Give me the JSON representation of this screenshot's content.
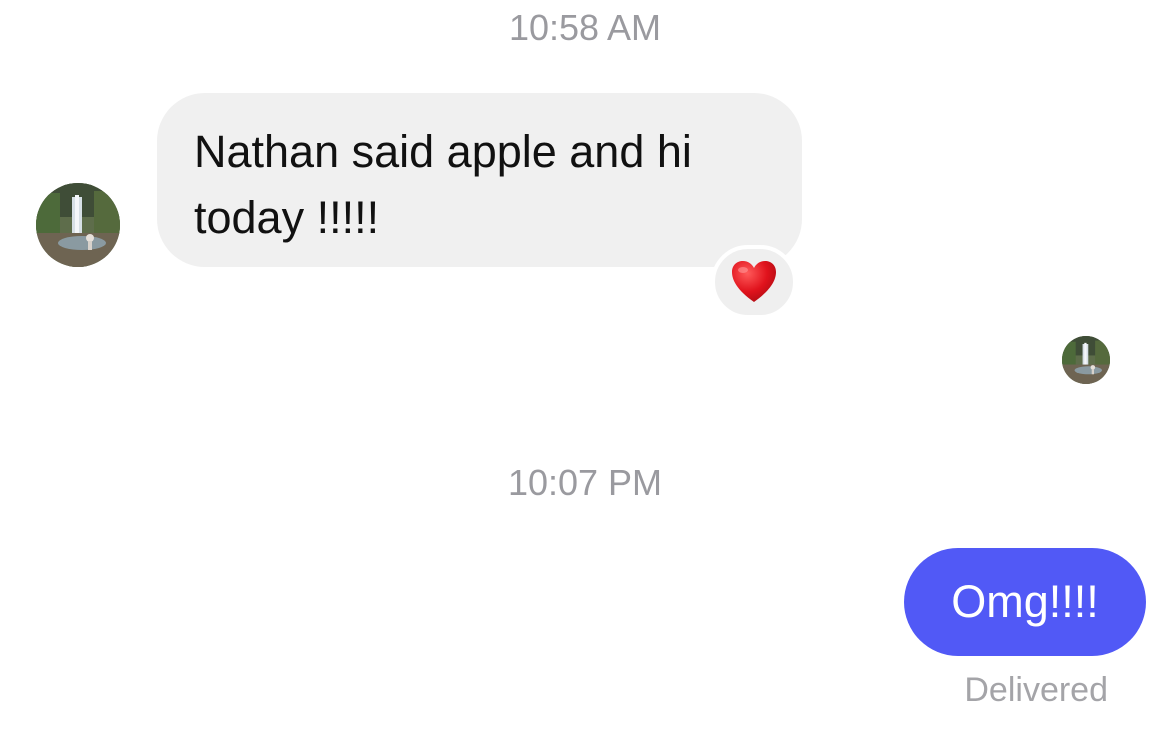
{
  "conversation": {
    "timestamp_1": "10:58 AM",
    "incoming_message": {
      "text": "Nathan said apple and hi today !!!!!",
      "reaction": "heart",
      "reaction_icon": "heart-icon",
      "bubble_color": "#f0f0f0"
    },
    "timestamp_2": "10:07 PM",
    "outgoing_message": {
      "text": "Omg!!!!",
      "bubble_color": "#5159f6",
      "status": "Delivered"
    }
  }
}
